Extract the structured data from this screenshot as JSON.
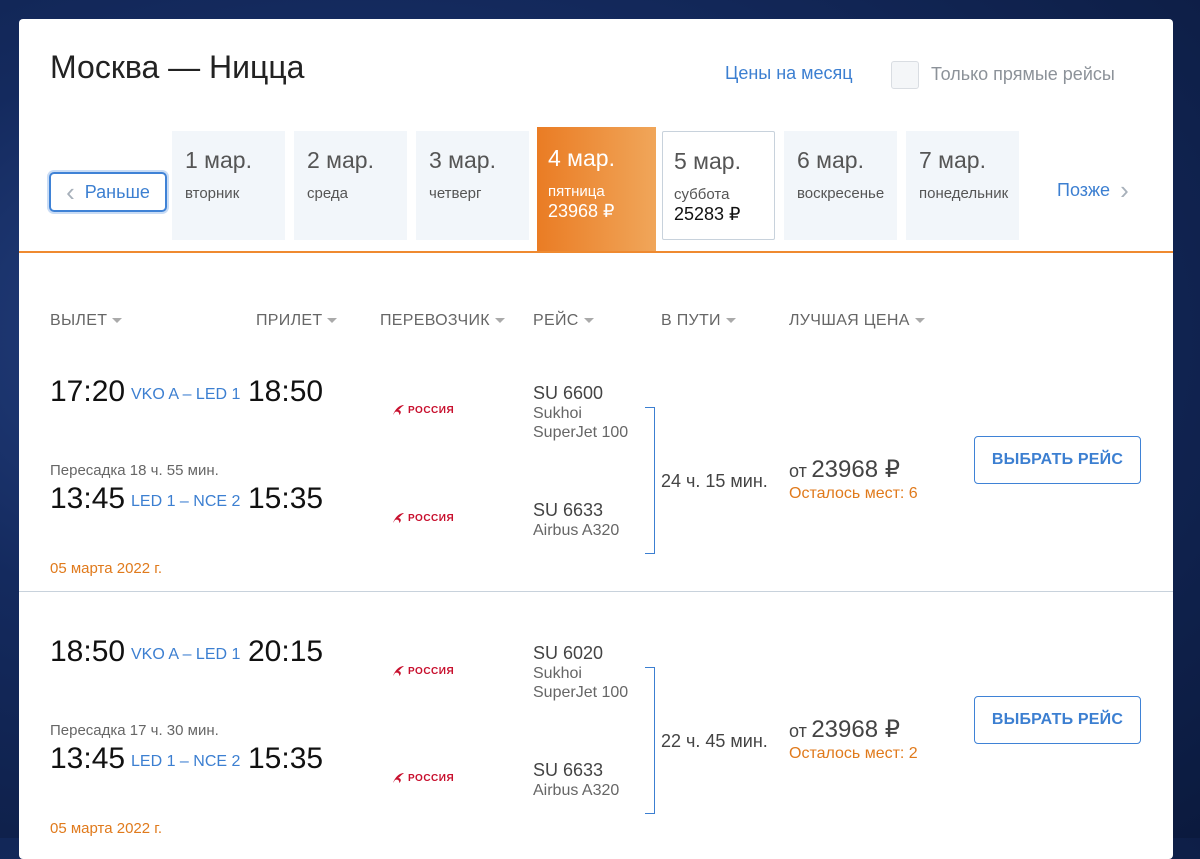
{
  "header": {
    "route": "Москва — Ницца",
    "month_prices_link": "Цены на месяц",
    "direct_only_label": "Только прямые рейсы",
    "direct_only_checked": false
  },
  "date_nav": {
    "earlier": "Раньше",
    "later": "Позже",
    "dates": [
      {
        "day": "1 мар.",
        "weekday": "вторник",
        "price": ""
      },
      {
        "day": "2 мар.",
        "weekday": "среда",
        "price": ""
      },
      {
        "day": "3 мар.",
        "weekday": "четверг",
        "price": ""
      },
      {
        "day": "4 мар.",
        "weekday": "пятница",
        "price": "23968 ₽",
        "selected": true
      },
      {
        "day": "5 мар.",
        "weekday": "суббота",
        "price": "25283 ₽"
      },
      {
        "day": "6 мар.",
        "weekday": "воскресенье",
        "price": ""
      },
      {
        "day": "7 мар.",
        "weekday": "понедельник",
        "price": ""
      }
    ]
  },
  "columns": {
    "departure": "ВЫЛЕТ",
    "arrival": "ПРИЛЕТ",
    "carrier": "ПЕРЕВОЗЧИК",
    "flight": "РЕЙС",
    "duration": "В ПУТИ",
    "best_price": "ЛУЧШАЯ ЦЕНА"
  },
  "colors": {
    "accent": "#ef8a30",
    "link": "#3c7fd1",
    "warning": "#e07a1c",
    "airline_red": "#c8102e"
  },
  "itineraries": [
    {
      "segments": [
        {
          "dep_time": "17:20",
          "airports": "VKO A – LED 1",
          "arr_time": "18:50",
          "airline": "РОССИЯ",
          "flight_no": "SU 6600",
          "aircraft": "Sukhoi SuperJet 100"
        },
        {
          "dep_time": "13:45",
          "airports": "LED 1 – NCE 2",
          "arr_time": "15:35",
          "airline": "РОССИЯ",
          "flight_no": "SU 6633",
          "aircraft": "Airbus A320"
        }
      ],
      "transfer": "Пересадка 18 ч. 55 мин.",
      "arrival_date": "05 марта 2022 г.",
      "duration": "24 ч. 15 мин.",
      "price_prefix": "от",
      "price": "23968 ₽",
      "seats_left": "Осталось мест: 6",
      "button": "ВЫБРАТЬ РЕЙС"
    },
    {
      "segments": [
        {
          "dep_time": "18:50",
          "airports": "VKO A – LED 1",
          "arr_time": "20:15",
          "airline": "РОССИЯ",
          "flight_no": "SU 6020",
          "aircraft": "Sukhoi SuperJet 100"
        },
        {
          "dep_time": "13:45",
          "airports": "LED 1 – NCE 2",
          "arr_time": "15:35",
          "airline": "РОССИЯ",
          "flight_no": "SU 6633",
          "aircraft": "Airbus A320"
        }
      ],
      "transfer": "Пересадка 17 ч. 30 мин.",
      "arrival_date": "05 марта 2022 г.",
      "duration": "22 ч. 45 мин.",
      "price_prefix": "от",
      "price": "23968 ₽",
      "seats_left": "Осталось мест: 2",
      "button": "ВЫБРАТЬ РЕЙС"
    }
  ]
}
